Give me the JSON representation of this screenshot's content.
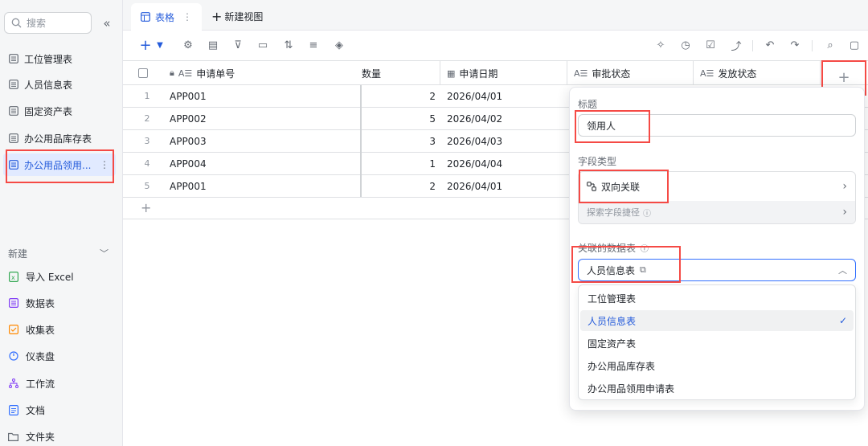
{
  "sidebar": {
    "search_placeholder": "搜索",
    "tables": [
      {
        "label": "工位管理表"
      },
      {
        "label": "人员信息表"
      },
      {
        "label": "固定资产表"
      },
      {
        "label": "办公用品库存表"
      },
      {
        "label": "办公用品领用..."
      }
    ],
    "new_label": "新建",
    "create_items": [
      {
        "label": "导入 Excel",
        "icon": "excel-icon",
        "color": "#34a853"
      },
      {
        "label": "数据表",
        "icon": "table-icon",
        "color": "#7f3bf5"
      },
      {
        "label": "收集表",
        "icon": "form-icon",
        "color": "#ff8800"
      },
      {
        "label": "仪表盘",
        "icon": "dashboard-icon",
        "color": "#3370ff"
      },
      {
        "label": "工作流",
        "icon": "workflow-icon",
        "color": "#7f3bf5"
      },
      {
        "label": "文档",
        "icon": "doc-icon",
        "color": "#3370ff"
      },
      {
        "label": "文件夹",
        "icon": "folder-icon",
        "color": "#646a73"
      }
    ]
  },
  "tabs": {
    "active": "表格",
    "new_view": "新建视图"
  },
  "grid": {
    "columns": [
      "申请单号",
      "数量",
      "申请日期",
      "审批状态",
      "发放状态"
    ],
    "qty_header_visible": "数量",
    "rows": [
      {
        "num": "1",
        "id": "APP001",
        "qty": "2",
        "date": "2026/04/01"
      },
      {
        "num": "2",
        "id": "APP002",
        "qty": "5",
        "date": "2026/04/02"
      },
      {
        "num": "3",
        "id": "APP003",
        "qty": "3",
        "date": "2026/04/03"
      },
      {
        "num": "4",
        "id": "APP004",
        "qty": "1",
        "date": "2026/04/04"
      },
      {
        "num": "5",
        "id": "APP001",
        "qty": "2",
        "date": "2026/04/01"
      }
    ]
  },
  "panel": {
    "title_label": "标题",
    "title_value": "领用人",
    "type_label": "字段类型",
    "type_value": "双向关联",
    "explore_label": "探索字段捷径",
    "linked_label": "关联的数据表",
    "linked_value": "人员信息表",
    "options": [
      {
        "label": "工位管理表",
        "selected": false
      },
      {
        "label": "人员信息表",
        "selected": true
      },
      {
        "label": "固定资产表",
        "selected": false
      },
      {
        "label": "办公用品库存表",
        "selected": false
      },
      {
        "label": "办公用品领用申请表",
        "selected": false
      }
    ]
  },
  "colors": {
    "accent": "#245bdb",
    "highlight": "#f54a45"
  }
}
